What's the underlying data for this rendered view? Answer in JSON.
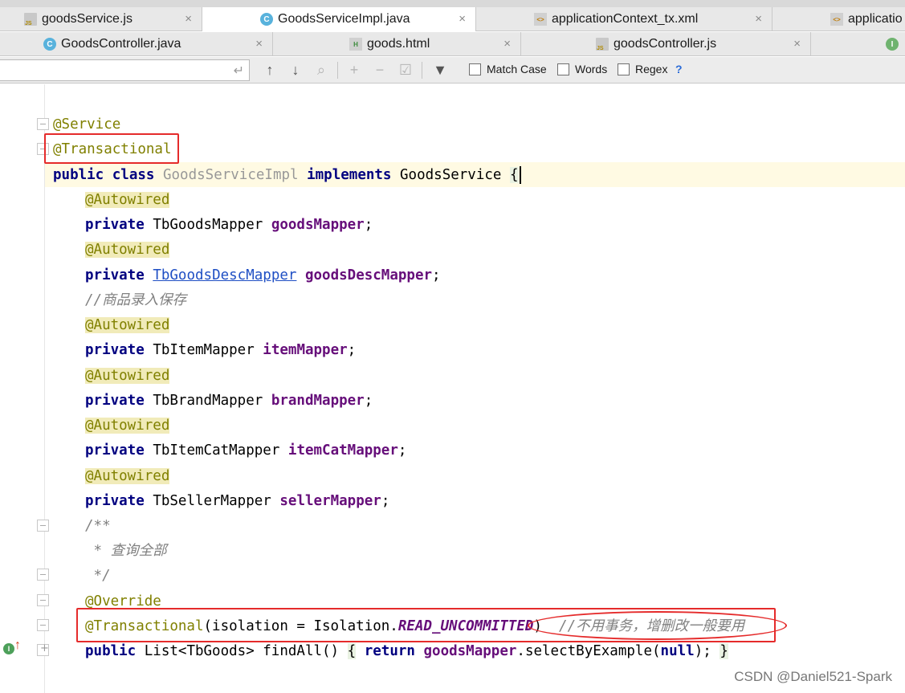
{
  "tabs_row1": [
    {
      "label": "goodsService.js",
      "icon": "javascript-file-icon",
      "active": false
    },
    {
      "label": "GoodsServiceImpl.java",
      "icon": "java-class-icon",
      "active": true
    },
    {
      "label": "applicationContext_tx.xml",
      "icon": "xml-file-icon",
      "active": false
    },
    {
      "label": "applicatio",
      "icon": "xml-file-icon",
      "active": false
    }
  ],
  "tabs_row2": [
    {
      "label": "GoodsController.java",
      "icon": "java-class-icon",
      "active": false
    },
    {
      "label": "goods.html",
      "icon": "html-file-icon",
      "active": false
    },
    {
      "label": "goodsController.js",
      "icon": "javascript-file-icon",
      "active": false
    }
  ],
  "search": {
    "value": "",
    "match_case": "Match Case",
    "words": "Words",
    "regex": "Regex",
    "help": "?"
  },
  "code": {
    "l1_ann": "@Service",
    "l2_ann": "@Transactional",
    "l3_kw1": "public class",
    "l3_cls": "GoodsServiceImpl",
    "l3_kw2": "implements",
    "l3_iface": "GoodsService",
    "l3_brace": "{",
    "autowired": "@Autowired",
    "private": "private",
    "t1": "TbGoodsMapper",
    "f1": "goodsMapper",
    "t2": "TbGoodsDescMapper",
    "f2": "goodsDescMapper",
    "c1": "//商品录入保存",
    "t3": "TbItemMapper",
    "f3": "itemMapper",
    "t4": "TbBrandMapper",
    "f4": "brandMapper",
    "t5": "TbItemCatMapper",
    "f5": "itemCatMapper",
    "t6": "TbSellerMapper",
    "f6": "sellerMapper",
    "semi": ";",
    "doc1": "/**",
    "doc2": " * 查询全部",
    "doc3": " */",
    "override": "@Override",
    "tx_ann": "@Transactional",
    "tx_args_pre": "(isolation = Isolation.",
    "tx_const": "READ_UNCOMMITTED",
    "tx_close": ")",
    "tx_comment": "//不用事务，增删改一般要用",
    "m_kw": "public",
    "m_sig": "List<TbGoods> findAll()",
    "m_open": "{",
    "m_ret": "return",
    "m_field": "goodsMapper",
    "m_call": ".selectByExample(",
    "m_null": "null",
    "m_end": ");",
    "m_close": "}"
  },
  "watermark": "CSDN @Daniel521-Spark",
  "colors": {
    "annotation": "#808000",
    "keyword": "#000080",
    "field": "#660e7a",
    "comment": "#808080",
    "highlight_box": "#e52b2b"
  }
}
